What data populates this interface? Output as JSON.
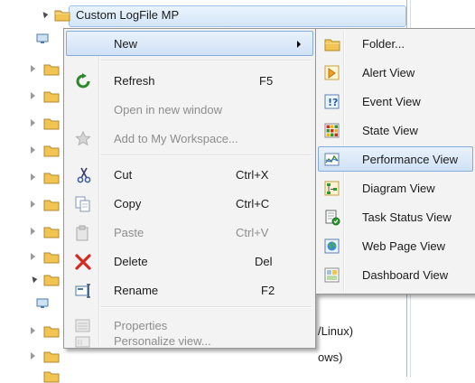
{
  "tree": {
    "root_label": "Custom LogFile MP",
    "partial_labels": [
      "/Linux)",
      "ows)"
    ]
  },
  "context_menu": {
    "items": [
      {
        "label": "New",
        "shortcut": "",
        "icon": "none",
        "enabled": true,
        "submenu": true
      },
      {
        "label": "Refresh",
        "shortcut": "F5",
        "icon": "refresh-icon",
        "enabled": true
      },
      {
        "label": "Open in new window",
        "shortcut": "",
        "icon": "none",
        "enabled": false
      },
      {
        "label": "Add to My Workspace...",
        "shortcut": "",
        "icon": "star-icon",
        "enabled": false
      },
      {
        "label": "Cut",
        "shortcut": "Ctrl+X",
        "icon": "scissors-icon",
        "enabled": true
      },
      {
        "label": "Copy",
        "shortcut": "Ctrl+C",
        "icon": "copy-icon",
        "enabled": true
      },
      {
        "label": "Paste",
        "shortcut": "Ctrl+V",
        "icon": "paste-icon",
        "enabled": false
      },
      {
        "label": "Delete",
        "shortcut": "Del",
        "icon": "delete-x-icon",
        "enabled": true
      },
      {
        "label": "Rename",
        "shortcut": "F2",
        "icon": "rename-icon",
        "enabled": true
      },
      {
        "label": "Properties",
        "shortcut": "",
        "icon": "properties-icon",
        "enabled": false
      },
      {
        "label": "Personalize view...",
        "shortcut": "",
        "icon": "personalize-icon",
        "enabled": false
      }
    ]
  },
  "submenu": {
    "items": [
      {
        "label": "Folder...",
        "icon": "folder-icon"
      },
      {
        "label": "Alert View",
        "icon": "alert-view-icon"
      },
      {
        "label": "Event View",
        "icon": "event-view-icon"
      },
      {
        "label": "State View",
        "icon": "state-view-icon"
      },
      {
        "label": "Performance View",
        "icon": "performance-view-icon",
        "highlighted": true
      },
      {
        "label": "Diagram View",
        "icon": "diagram-view-icon"
      },
      {
        "label": "Task Status View",
        "icon": "task-status-view-icon"
      },
      {
        "label": "Web Page View",
        "icon": "web-page-view-icon"
      },
      {
        "label": "Dashboard View",
        "icon": "dashboard-view-icon"
      }
    ]
  },
  "colors": {
    "menu_bg": "#f3f3f3",
    "highlight_border": "#84acdd",
    "folder_yellow": "#f2c552",
    "delete_red": "#d42a1f"
  }
}
